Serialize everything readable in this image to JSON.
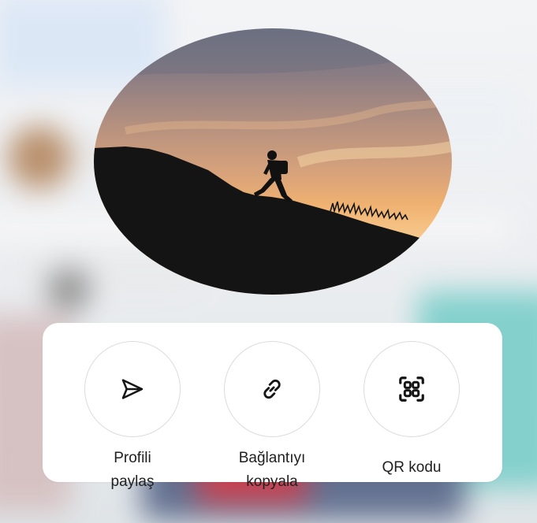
{
  "overlay": {
    "profile_photo": {
      "alt": "profile-photo",
      "content": "silhouette of hiker climbing hill at sunset"
    }
  },
  "share_sheet": {
    "actions": [
      {
        "icon": "send-icon",
        "label": "Profili\npaylaş"
      },
      {
        "icon": "link-icon",
        "label": "Bağlantıyı\nkopyala"
      },
      {
        "icon": "qr-code-icon",
        "label": "QR kodu"
      }
    ]
  },
  "colors": {
    "card_background": "#ffffff",
    "circle_border": "#dcdcdc",
    "label_text": "#202020"
  }
}
